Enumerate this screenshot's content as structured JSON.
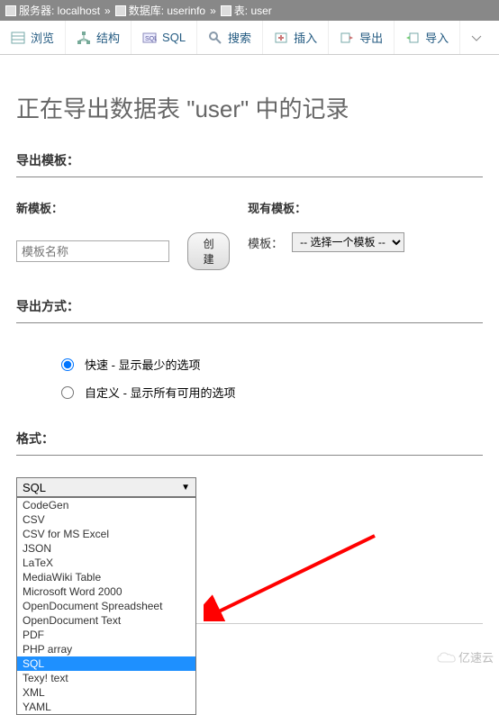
{
  "breadcrumb": {
    "server_label": "服务器: localhost",
    "database_label": "数据库: userinfo",
    "table_label": "表: user",
    "sep": "»"
  },
  "tabs": {
    "browse": "浏览",
    "structure": "结构",
    "sql": "SQL",
    "search": "搜索",
    "insert": "插入",
    "export": "导出",
    "import": "导入"
  },
  "page_title": "正在导出数据表 \"user\" 中的记录",
  "sections": {
    "export_template": "导出模板：",
    "new_template": "新模板：",
    "existing_template": "现有模板：",
    "template_name_placeholder": "模板名称",
    "create_button": "创建",
    "template_label": "模板：",
    "template_select_placeholder": "-- 选择一个模板 --",
    "export_method": "导出方式：",
    "method_quick": "快速 - 显示最少的选项",
    "method_custom": "自定义 - 显示所有可用的选项",
    "format": "格式："
  },
  "format_select": {
    "selected": "SQL",
    "options": [
      "CodeGen",
      "CSV",
      "CSV for MS Excel",
      "JSON",
      "LaTeX",
      "MediaWiki Table",
      "Microsoft Word 2000",
      "OpenDocument Spreadsheet",
      "OpenDocument Text",
      "PDF",
      "PHP array",
      "SQL",
      "Texy! text",
      "XML",
      "YAML"
    ]
  },
  "watermark": "亿速云"
}
